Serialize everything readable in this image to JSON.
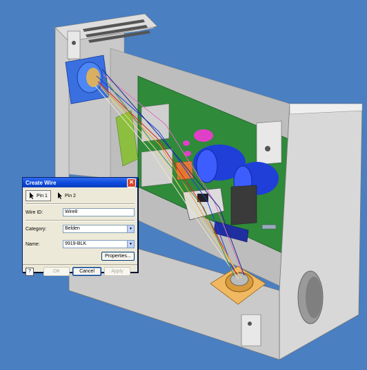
{
  "dialog": {
    "title": "Create Wire",
    "close_icon": "close-icon",
    "pin1_label": "Pin 1",
    "pin2_label": "Pin 2",
    "wire_id_label": "Wire ID:",
    "wire_id_value": "Wire8",
    "category_label": "Category:",
    "category_value": "Belden",
    "name_label": "Name:",
    "name_value": "9919-BLK",
    "properties_label": "Properties...",
    "ok_label": "OK",
    "cancel_label": "Cancel",
    "apply_label": "Apply"
  },
  "colors": {
    "background": "#4a7fc1",
    "enclosure": "#d8d8d8",
    "pcb": "#2f8a3a",
    "capacitor": "#1f3fd8",
    "connector_blue": "#3a6fe0",
    "connector_gold": "#f0b860"
  }
}
